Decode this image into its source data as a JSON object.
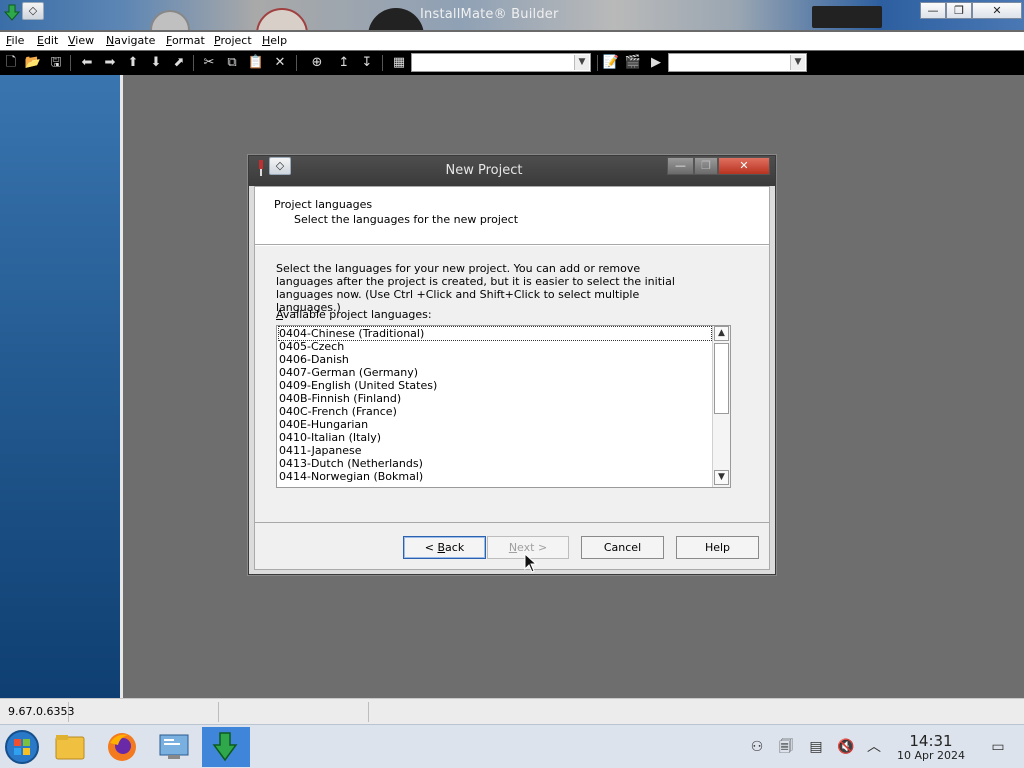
{
  "app": {
    "title": "InstallMate® Builder"
  },
  "window_controls": {
    "minimize": "—",
    "maximize": "❐",
    "close": "✕"
  },
  "menu": [
    {
      "label": "File",
      "mnemonic": "F",
      "rest": "ile"
    },
    {
      "label": "Edit",
      "mnemonic": "E",
      "rest": "dit"
    },
    {
      "label": "View",
      "mnemonic": "V",
      "rest": "iew"
    },
    {
      "label": "Navigate",
      "mnemonic": "N",
      "rest": "avigate"
    },
    {
      "label": "Format",
      "mnemonic": "F",
      "rest": "ormat"
    },
    {
      "label": "Project",
      "mnemonic": "P",
      "rest": "roject"
    },
    {
      "label": "Help",
      "mnemonic": "H",
      "rest": "elp"
    }
  ],
  "toolbar": {
    "combo1_value": "",
    "combo2_value": ""
  },
  "statusbar": {
    "version": "9.67.0.6353"
  },
  "dialog": {
    "title": "New Project",
    "header_title": "Project languages",
    "header_subtitle": "Select the languages for the new project",
    "description": "Select the languages for your new project. You can add or remove languages after the project is created, but it is easier to select the initial languages now. (Use Ctrl +Click and Shift+Click to select multiple languages.)",
    "list_label_mnemonic": "A",
    "list_label_rest": "vailable project languages:",
    "languages": [
      "0404-Chinese (Traditional)",
      "0405-Czech",
      "0406-Danish",
      "0407-German (Germany)",
      "0409-English (United States)",
      "040B-Finnish (Finland)",
      "040C-French (France)",
      "040E-Hungarian",
      "0410-Italian (Italy)",
      "0411-Japanese",
      "0413-Dutch (Netherlands)",
      "0414-Norwegian (Bokmal)"
    ],
    "buttons": {
      "back_pre": "< ",
      "back_mnemonic": "B",
      "back_rest": "ack",
      "next_mnemonic": "N",
      "next_rest": "ext >",
      "cancel": "Cancel",
      "help": "Help"
    }
  },
  "taskbar": {
    "time": "14:31",
    "date": "10 Apr 2024",
    "active_app": "InstallMate Builder"
  },
  "colors": {
    "accent": "#3f85d9",
    "left_panel": "#22598f",
    "default_button_border": "#2b62b0"
  }
}
